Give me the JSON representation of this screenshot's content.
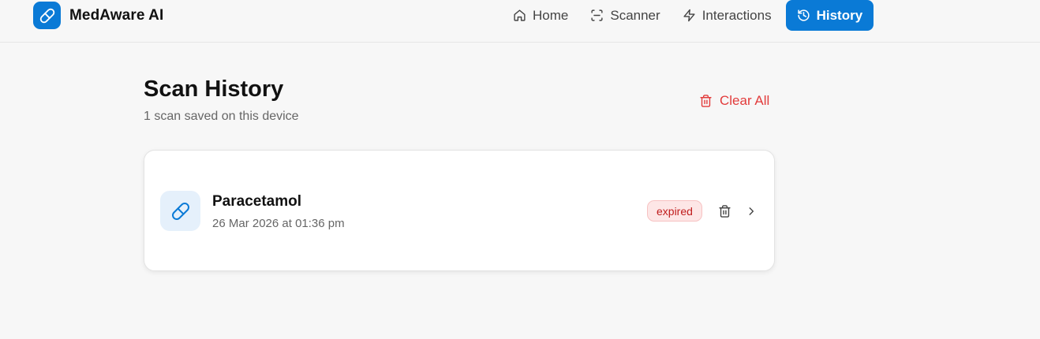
{
  "app": {
    "name": "MedAware AI",
    "brand_color": "#0a7ad6",
    "logo_icon": "pill-icon"
  },
  "nav": {
    "items": [
      {
        "label": "Home",
        "icon": "home-icon",
        "active": false
      },
      {
        "label": "Scanner",
        "icon": "scan-icon",
        "active": false
      },
      {
        "label": "Interactions",
        "icon": "lightning-icon",
        "active": false
      },
      {
        "label": "History",
        "icon": "history-icon",
        "active": true
      }
    ]
  },
  "page": {
    "title": "Scan History",
    "subtitle": "1 scan saved on this device",
    "clear_all_label": "Clear All"
  },
  "history": [
    {
      "name": "Paracetamol",
      "date": "26 Mar 2026 at 01:36 pm",
      "status": "expired",
      "status_color": "#c01d1d",
      "icon": "pill-icon"
    }
  ],
  "colors": {
    "accent": "#0a7ad6",
    "danger": "#e23b3b",
    "background": "#f7f7f7"
  }
}
